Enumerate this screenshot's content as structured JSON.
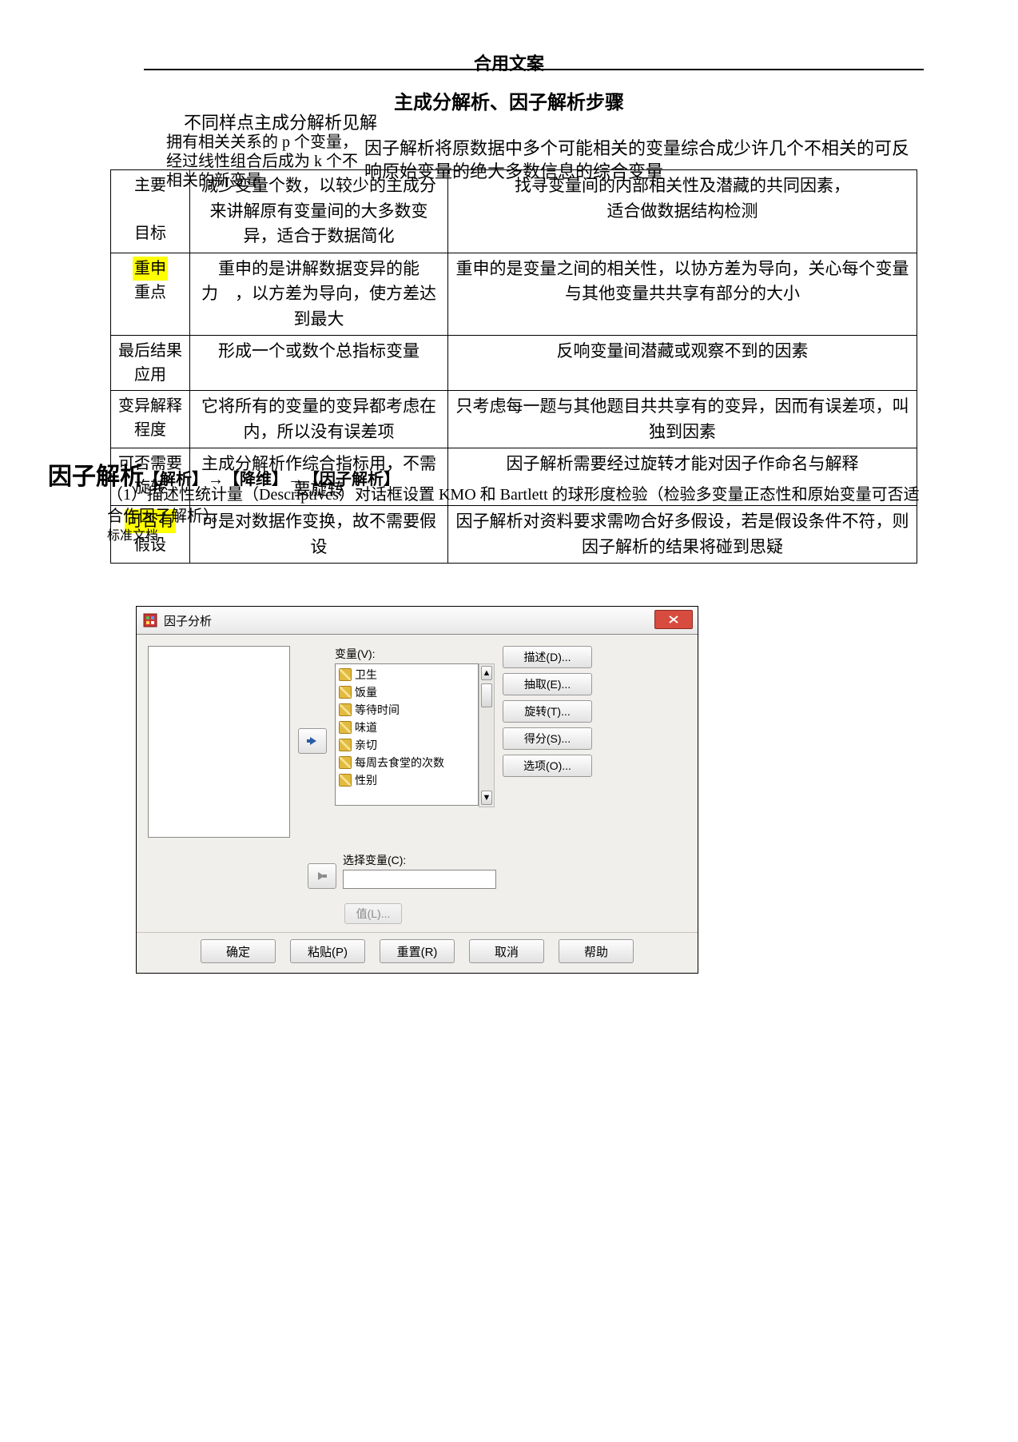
{
  "header": "合用文案",
  "title": "主成分解析、因子解析步骤",
  "intro": {
    "pca_line1": "不同样点主成分解析见解",
    "pca_line2": "拥有相关关系的 p 个变量，经过线性组合后成为 k 个不相关的新变量",
    "fa": "因子解析将原数据中多个可能相关的变量综合成少许几个不相关的可反响原始变量的绝大多数信息的综合变量"
  },
  "rows": [
    {
      "label": "主要\n\n目标",
      "pca": "减少变量个数，以较少的主成分来讲解原有变量间的大多数变异，适合于数据简化",
      "fa": "找寻变量间的内部相关性及潜藏的共同因素，\n适合做数据结构检测"
    },
    {
      "labelHL": "重申",
      "label_rest": "\n重点",
      "pca": "重申的是讲解数据变异的能力　，以方差为导向，使方差达到最大",
      "fa": "重申的是变量之间的相关性，以协方差为导向，关心每个变量与其他变量共共享有部分的大小"
    },
    {
      "label": "最后结果应用",
      "pca": "形成一个或数个总指标变量",
      "fa": "反响变量间潜藏或观察不到的因素"
    },
    {
      "label": "变异解释程度",
      "pca": "它将所有的变量的变异都考虑在内，所以没有误差项",
      "fa": "只考虑每一题与其他题目共共享有的变异，因而有误差项，叫独到因素"
    },
    {
      "label": "可否需要旋转",
      "pca": "主成分解析作综合指标用，不需要旋转",
      "fa": "因子解析需要经过旋转才能对因子作命名与解释"
    },
    {
      "labelHL": "可否有",
      "label_rest": "\n假设",
      "pca": "可是对数据作变换，故不需要假设",
      "fa": "因子解析对资料要求需吻合好多假设，若是假设条件不符，则因子解析的结果将碰到思疑"
    }
  ],
  "section": {
    "heading": "因子解析",
    "path": "【解析】→【降维】→【因子解析】",
    "para": "（1）描述性统计量（Descriptives）对话框设置 KMO 和 Bartlett 的球形度检验（检验多变量正态性和原始变量可否适合作因子解析）。",
    "stddoc": "标准文档"
  },
  "dialog": {
    "title": "因子分析",
    "vars_label": "变量(V):",
    "vars": [
      "卫生",
      "饭量",
      "等待时间",
      "味道",
      "亲切",
      "每周去食堂的次数",
      "性别"
    ],
    "sel_label": "选择变量(C):",
    "value_btn": "值(L)...",
    "side": [
      {
        "t": "描述(D)..."
      },
      {
        "t": "抽取(E)..."
      },
      {
        "t": "旋转(T)..."
      },
      {
        "t": "得分(S)..."
      },
      {
        "t": "选项(O)..."
      }
    ],
    "footer": [
      "确定",
      "粘贴(P)",
      "重置(R)",
      "取消",
      "帮助"
    ]
  }
}
